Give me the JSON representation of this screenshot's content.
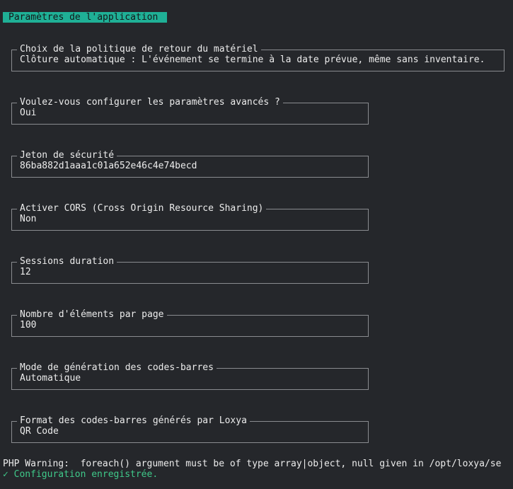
{
  "header": {
    "title": "Paramètres de l'application"
  },
  "fields": [
    {
      "label": "Choix de la politique de retour du matériel",
      "value": "Clôture automatique : L'événement se termine à la date prévue, même sans inventaire."
    },
    {
      "label": "Voulez-vous configurer les paramètres avancés ?",
      "value": "Oui"
    },
    {
      "label": "Jeton de sécurité",
      "value": "86ba882d1aaa1c01a652e46c4e74becd"
    },
    {
      "label": "Activer CORS (Cross Origin Resource Sharing)",
      "value": "Non"
    },
    {
      "label": "Sessions duration",
      "value": "12"
    },
    {
      "label": "Nombre d'éléments par page",
      "value": "100"
    },
    {
      "label": "Mode de génération des codes-barres",
      "value": "Automatique"
    },
    {
      "label": "Format des codes-barres générés par Loxya",
      "value": "QR Code"
    }
  ],
  "messages": {
    "warning": "PHP Warning:  foreach() argument must be of type array|object, null given in /opt/loxya/se",
    "success_icon": "check-icon",
    "success_mark": "✓",
    "success_text": "Configuration enregistrée."
  },
  "colors": {
    "background": "#25272b",
    "accent": "#1fb096",
    "success": "#3fc98a"
  }
}
